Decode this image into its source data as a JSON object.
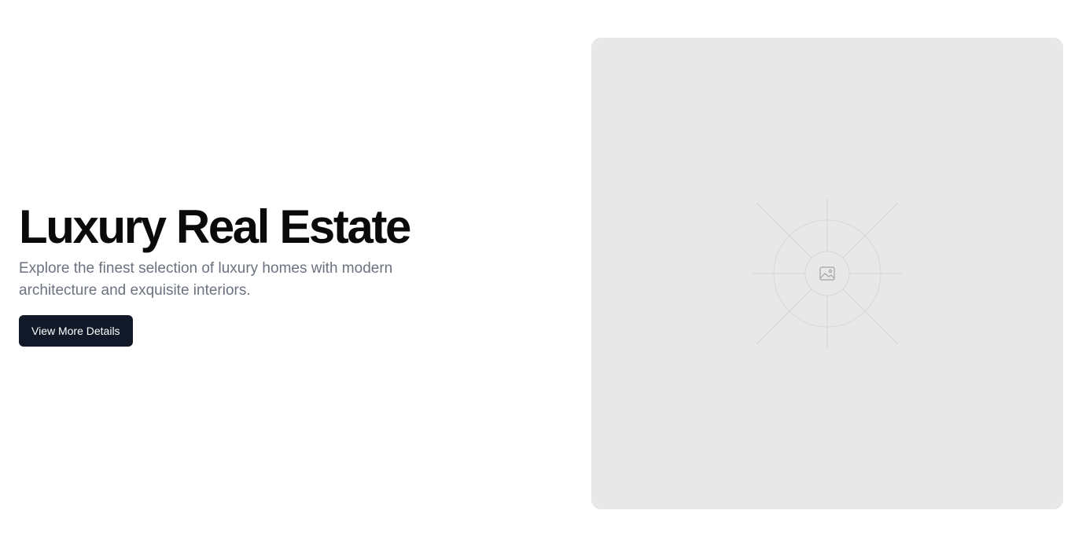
{
  "hero": {
    "title": "Luxury Real Estate",
    "subtitle": "Explore the finest selection of luxury homes with modern architecture and exquisite interiors.",
    "cta_label": "View More Details"
  },
  "image_placeholder": {
    "icon": "image-icon"
  },
  "colors": {
    "title": "#0a0a0a",
    "subtitle": "#6b7280",
    "button_bg": "#111827",
    "button_text": "#ffffff",
    "placeholder_bg": "#e8e8e8"
  }
}
